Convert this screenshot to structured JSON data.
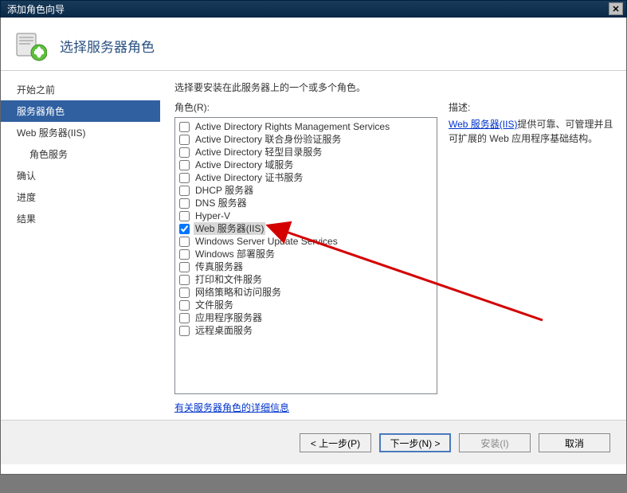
{
  "window": {
    "title": "添加角色向导",
    "close_icon": "✕"
  },
  "header": {
    "title": "选择服务器角色"
  },
  "sidebar": {
    "items": [
      {
        "label": "开始之前",
        "active": false,
        "indent": false
      },
      {
        "label": "服务器角色",
        "active": true,
        "indent": false
      },
      {
        "label": "Web 服务器(IIS)",
        "active": false,
        "indent": false
      },
      {
        "label": "角色服务",
        "active": false,
        "indent": true
      },
      {
        "label": "确认",
        "active": false,
        "indent": false
      },
      {
        "label": "进度",
        "active": false,
        "indent": false
      },
      {
        "label": "结果",
        "active": false,
        "indent": false
      }
    ]
  },
  "main": {
    "instruction": "选择要安装在此服务器上的一个或多个角色。",
    "roles_label": "角色(R):",
    "roles": [
      {
        "label": "Active Directory Rights Management Services",
        "checked": false,
        "selected": false
      },
      {
        "label": "Active Directory 联合身份验证服务",
        "checked": false,
        "selected": false
      },
      {
        "label": "Active Directory 轻型目录服务",
        "checked": false,
        "selected": false
      },
      {
        "label": "Active Directory 域服务",
        "checked": false,
        "selected": false
      },
      {
        "label": "Active Directory 证书服务",
        "checked": false,
        "selected": false
      },
      {
        "label": "DHCP 服务器",
        "checked": false,
        "selected": false
      },
      {
        "label": "DNS 服务器",
        "checked": false,
        "selected": false
      },
      {
        "label": "Hyper-V",
        "checked": false,
        "selected": false
      },
      {
        "label": "Web 服务器(IIS)",
        "checked": true,
        "selected": true
      },
      {
        "label": "Windows Server Update Services",
        "checked": false,
        "selected": false
      },
      {
        "label": "Windows 部署服务",
        "checked": false,
        "selected": false
      },
      {
        "label": "传真服务器",
        "checked": false,
        "selected": false
      },
      {
        "label": "打印和文件服务",
        "checked": false,
        "selected": false
      },
      {
        "label": "网络策略和访问服务",
        "checked": false,
        "selected": false
      },
      {
        "label": "文件服务",
        "checked": false,
        "selected": false
      },
      {
        "label": "应用程序服务器",
        "checked": false,
        "selected": false
      },
      {
        "label": "远程桌面服务",
        "checked": false,
        "selected": false
      }
    ],
    "details_link": "有关服务器角色的详细信息",
    "desc_label": "描述:",
    "desc_link": "Web 服务器(IIS)",
    "desc_text": "提供可靠、可管理并且可扩展的 Web 应用程序基础结构。"
  },
  "buttons": {
    "prev": "< 上一步(P)",
    "next": "下一步(N) >",
    "install": "安装(I)",
    "cancel": "取消"
  }
}
